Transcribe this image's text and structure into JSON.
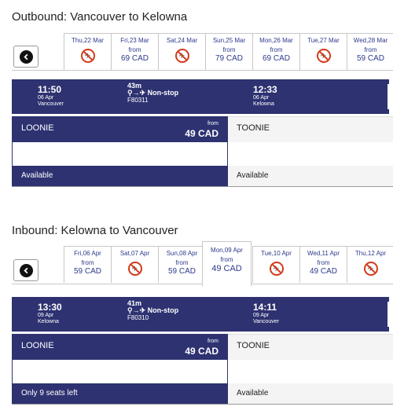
{
  "outbound": {
    "title": "Outbound: Vancouver to Kelowna",
    "dates": [
      {
        "day": "Thu,22 Mar",
        "available": false,
        "from": "",
        "price": ""
      },
      {
        "day": "Fri,23 Mar",
        "available": true,
        "from": "from",
        "price": "69 CAD"
      },
      {
        "day": "Sat,24 Mar",
        "available": false,
        "from": "",
        "price": ""
      },
      {
        "day": "Sun,25 Mar",
        "available": true,
        "from": "from",
        "price": "79 CAD"
      },
      {
        "day": "Mon,26 Mar",
        "available": true,
        "from": "from",
        "price": "69 CAD"
      },
      {
        "day": "Tue,27 Mar",
        "available": false,
        "from": "",
        "price": ""
      },
      {
        "day": "Wed,28 Mar",
        "available": true,
        "from": "from",
        "price": "59 CAD"
      }
    ],
    "flight": {
      "dep_time": "11:50",
      "dep_date": "06 Apr",
      "dep_city": "Vancouver",
      "duration": "43m",
      "route_icon": "pin-arrow-plane-icon",
      "stops": "Non-stop",
      "number": "F80311",
      "arr_time": "12:33",
      "arr_date": "06 Apr",
      "arr_city": "Kelowna"
    },
    "fares": {
      "loonie": {
        "name": "LOONIE",
        "from": "from",
        "amount": "49 CAD",
        "status": "Available"
      },
      "toonie": {
        "name": "TOONIE",
        "status": "Available"
      }
    }
  },
  "inbound": {
    "title": "Inbound: Kelowna to Vancouver",
    "dates": [
      {
        "day": "Fri,06 Apr",
        "available": true,
        "from": "from",
        "price": "59 CAD"
      },
      {
        "day": "Sat,07 Apr",
        "available": false,
        "from": "",
        "price": ""
      },
      {
        "day": "Sun,08 Apr",
        "available": true,
        "from": "from",
        "price": "59 CAD"
      },
      {
        "day": "Mon,09 Apr",
        "available": true,
        "from": "from",
        "price": "49 CAD",
        "selected": true
      },
      {
        "day": "Tue,10 Apr",
        "available": false,
        "from": "",
        "price": ""
      },
      {
        "day": "Wed,11 Apr",
        "available": true,
        "from": "from",
        "price": "49 CAD"
      },
      {
        "day": "Thu,12 Apr",
        "available": false,
        "from": "",
        "price": ""
      }
    ],
    "flight": {
      "dep_time": "13:30",
      "dep_date": "09 Apr",
      "dep_city": "Kelowna",
      "duration": "41m",
      "route_icon": "pin-arrow-plane-icon",
      "stops": "Non-stop",
      "number": "F80310",
      "arr_time": "14:11",
      "arr_date": "09 Apr",
      "arr_city": "Vancouver"
    },
    "fares": {
      "loonie": {
        "name": "LOONIE",
        "from": "from",
        "amount": "49 CAD",
        "status": "Only 9 seats left"
      },
      "toonie": {
        "name": "TOONIE",
        "status": "Available"
      }
    }
  },
  "icons": {
    "back": "chevron-left-icon",
    "no_flight": "no-flight-icon"
  },
  "colors": {
    "bar": "#2e3271",
    "date_text": "#2e3a8c",
    "no_flight": "#d43a1c"
  }
}
